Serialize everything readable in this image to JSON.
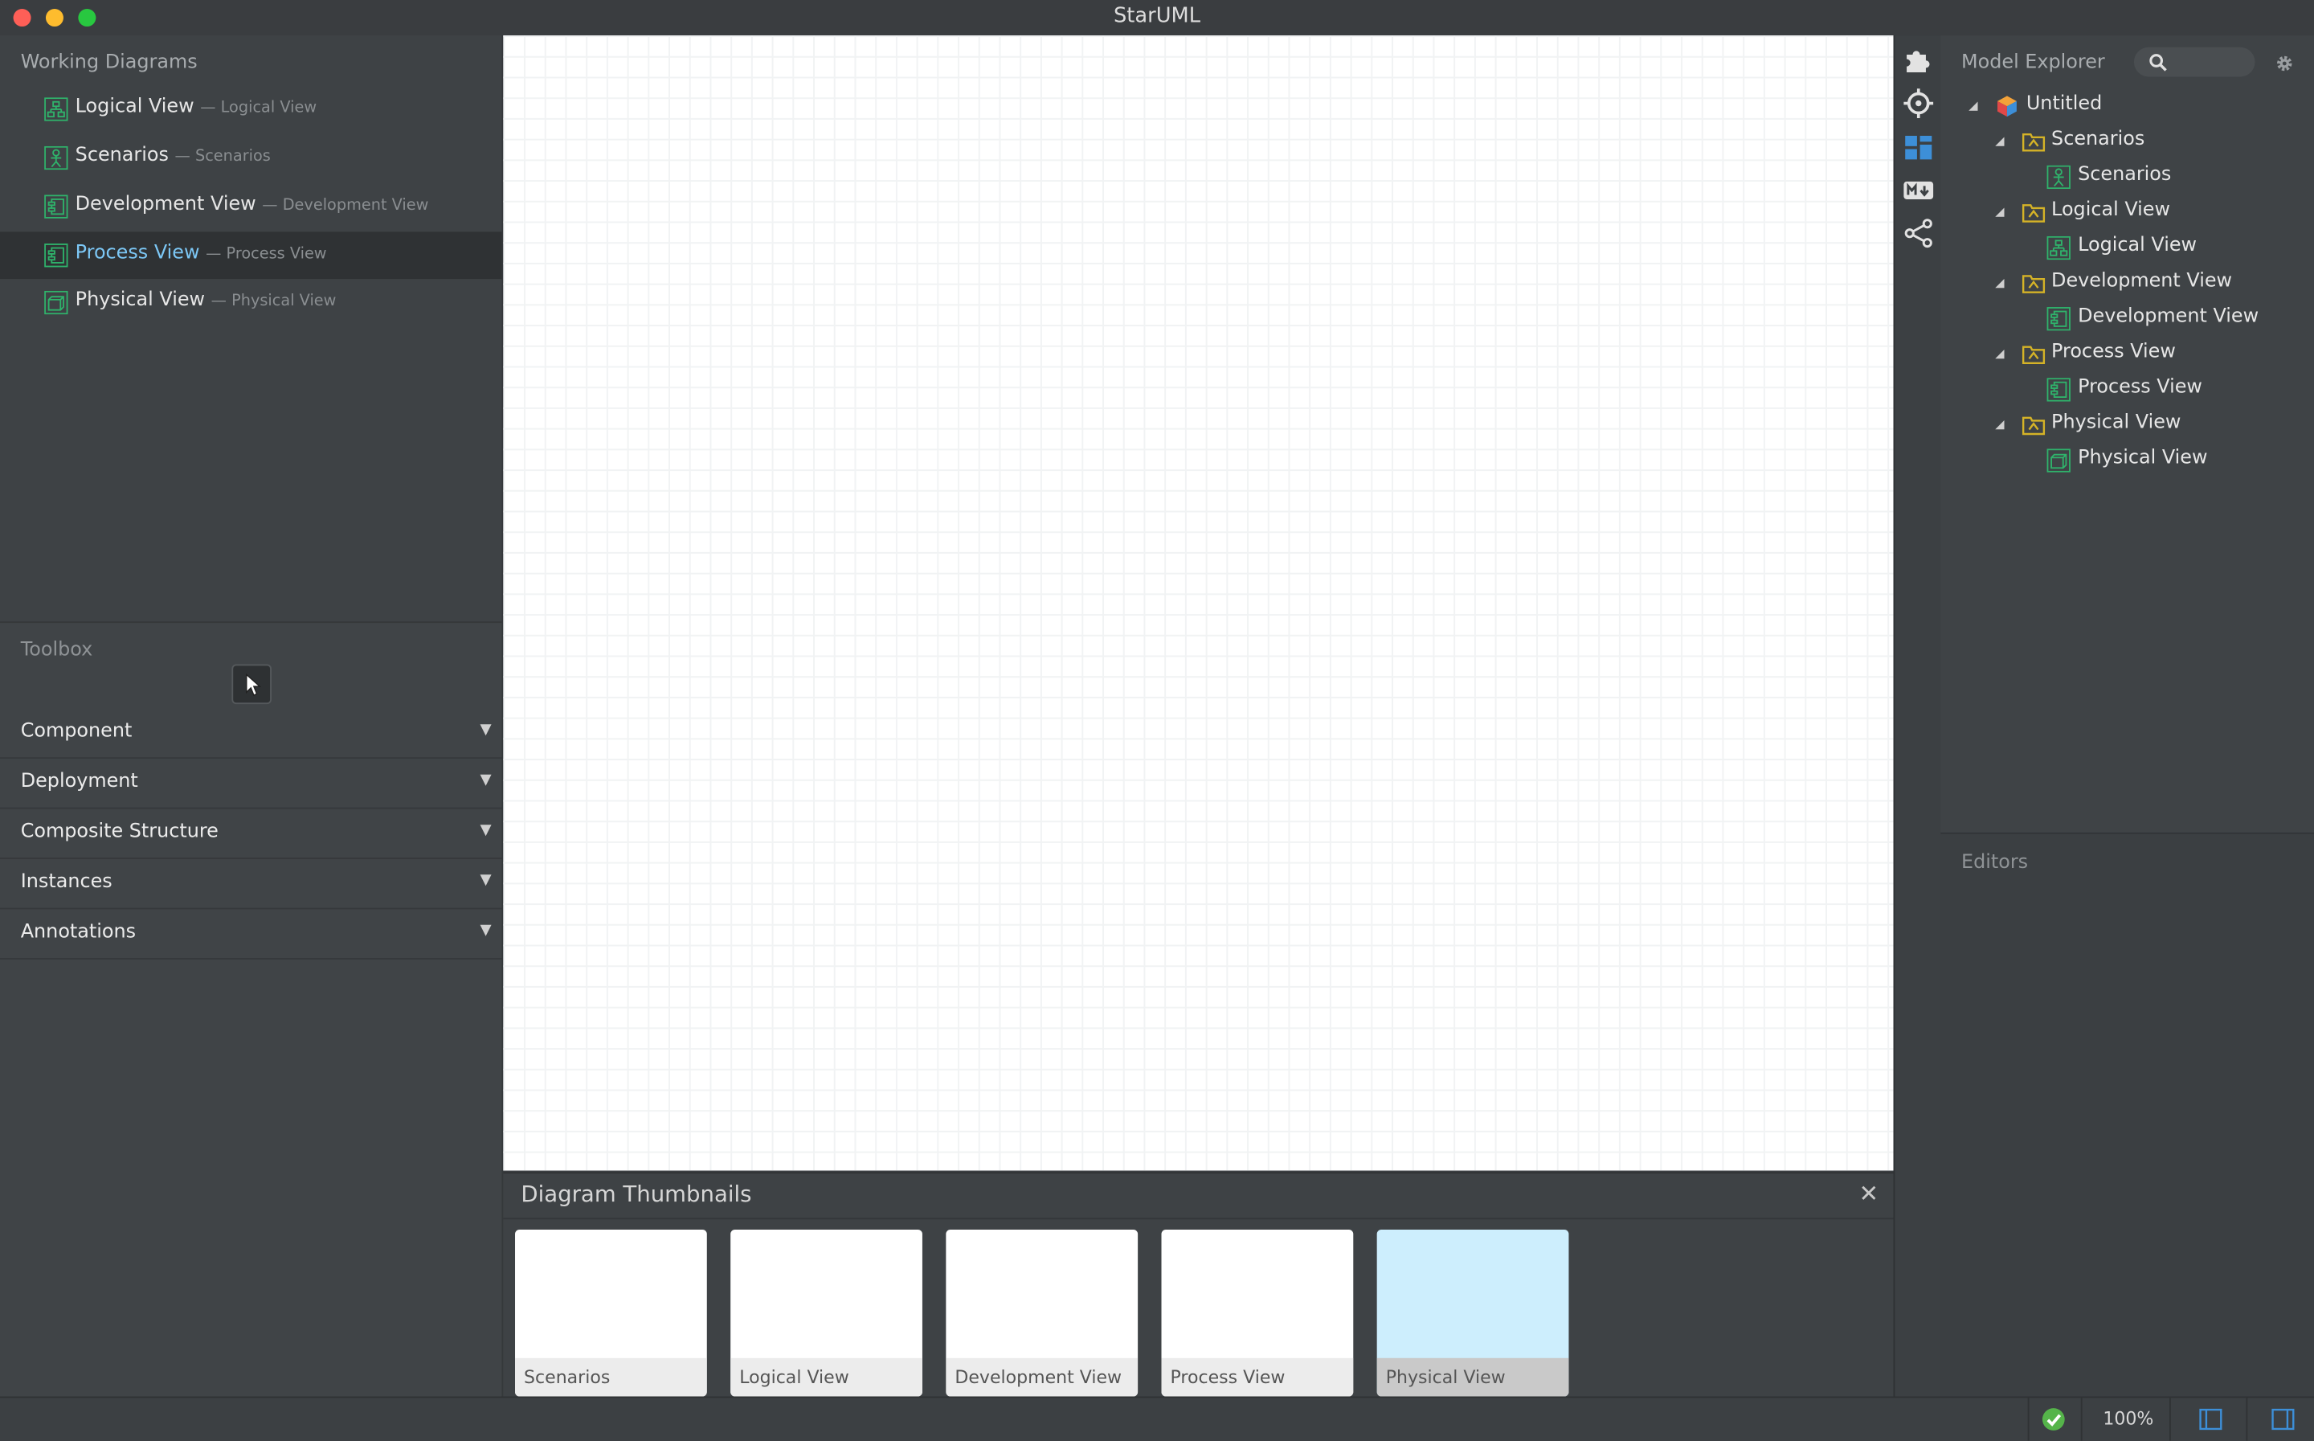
{
  "window": {
    "title": "StarUML"
  },
  "working_diagrams": {
    "title": "Working Diagrams",
    "items": [
      {
        "label": "Logical View",
        "sub": "— Logical View",
        "icon": "class-diagram-icon"
      },
      {
        "label": "Scenarios",
        "sub": "— Scenarios",
        "icon": "usecase-diagram-icon"
      },
      {
        "label": "Development View",
        "sub": "— Development View",
        "icon": "component-diagram-icon"
      },
      {
        "label": "Process View",
        "sub": "— Process View",
        "icon": "component-diagram-icon",
        "selected": true
      },
      {
        "label": "Physical View",
        "sub": "— Physical View",
        "icon": "deployment-diagram-icon"
      }
    ]
  },
  "toolbox": {
    "title": "Toolbox",
    "pointer_icon": "pointer-icon",
    "groups": [
      "Component",
      "Deployment",
      "Composite Structure",
      "Instances",
      "Annotations"
    ]
  },
  "thumbnails": {
    "title": "Diagram Thumbnails",
    "close": "✕",
    "items": [
      "Scenarios",
      "Logical View",
      "Development View",
      "Process View",
      "Physical View"
    ],
    "active_item": "Physical View"
  },
  "toolbar_icons": [
    "extension-manager-icon",
    "navigate-icon",
    "diagram-thumbnails-icon",
    "markdown-icon",
    "share-icon"
  ],
  "model_explorer": {
    "title": "Model Explorer",
    "search_icon": "search-icon",
    "settings_icon": "gear-icon",
    "root": "Untitled",
    "packages": [
      {
        "label": "Scenarios",
        "diagram": "Scenarios",
        "icon": "usecase-diagram-icon"
      },
      {
        "label": "Logical View",
        "diagram": "Logical View",
        "icon": "class-diagram-icon"
      },
      {
        "label": "Development View",
        "diagram": "Development View",
        "icon": "component-diagram-icon"
      },
      {
        "label": "Process View",
        "diagram": "Process View",
        "icon": "component-diagram-icon"
      },
      {
        "label": "Physical View",
        "diagram": "Physical View",
        "icon": "deployment-diagram-icon"
      }
    ]
  },
  "editors": {
    "title": "Editors"
  },
  "statusbar": {
    "zoom": "100%",
    "validation_icon": "check-icon"
  },
  "colors": {
    "accent": "#7cc7f5",
    "diagram_icon": "#2fb36b",
    "package_icon": "#d5b327"
  }
}
